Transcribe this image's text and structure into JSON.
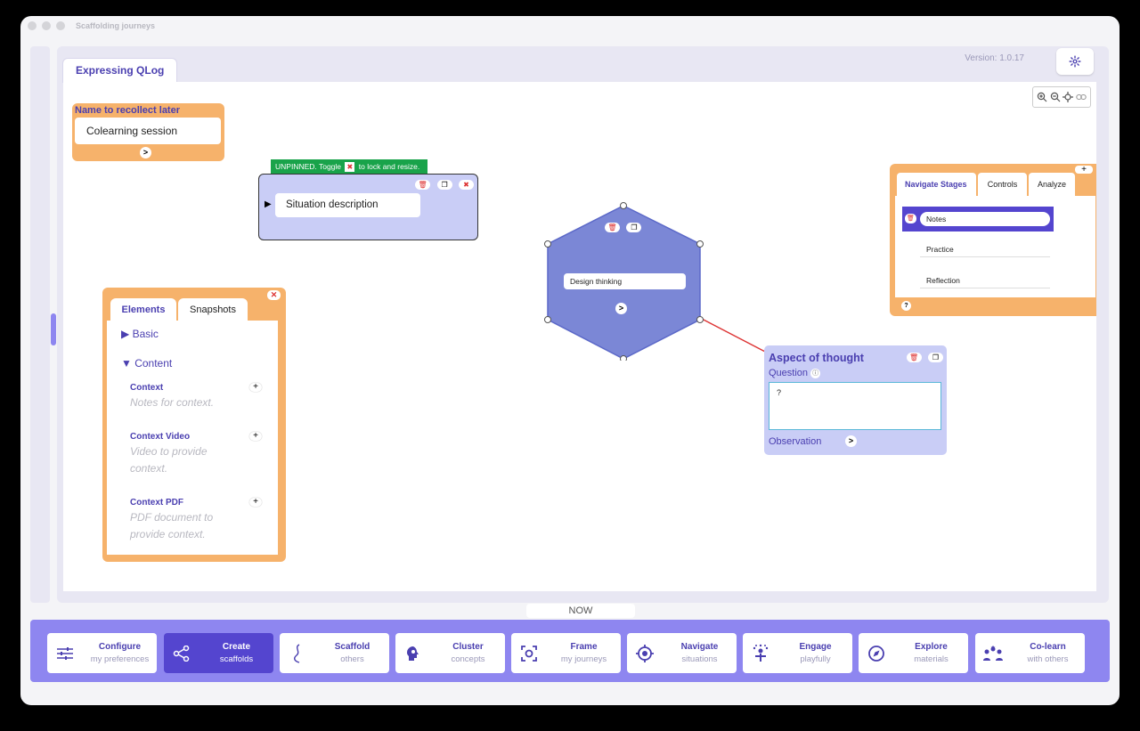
{
  "window": {
    "title": "Scaffolding journeys"
  },
  "header": {
    "tab": "Expressing QLog",
    "version": "Version: 1.0.17"
  },
  "name_card": {
    "label": "Name to recollect later",
    "value": "Colearning session",
    "next": ">"
  },
  "pin_banner": {
    "prefix": "UNPINNED. Toggle",
    "suffix": "to lock and resize."
  },
  "situation": {
    "arrow": "▶",
    "label": "Situation description"
  },
  "hexagon": {
    "label": "Design thinking",
    "next": ">"
  },
  "aspect": {
    "title": "Aspect of thought",
    "question_label": "Question",
    "question_value": "?",
    "observation_label": "Observation",
    "next": ">"
  },
  "elements_panel": {
    "tabs": [
      "Elements",
      "Snapshots"
    ],
    "groups": {
      "basic": "▶ Basic",
      "content": "▼ Content"
    },
    "items": [
      {
        "title": "Context",
        "desc": "Notes for context."
      },
      {
        "title": "Context Video",
        "desc": "Video to provide context."
      },
      {
        "title": "Context PDF",
        "desc": "PDF document to provide context."
      }
    ],
    "plus": "+"
  },
  "stages_panel": {
    "tabs": [
      "Navigate Stages",
      "Controls",
      "Analyze"
    ],
    "stages": [
      "Notes",
      "Practice",
      "Reflection"
    ],
    "help": "?",
    "plus": "+"
  },
  "now_label": "NOW",
  "nav": [
    {
      "title": "Configure",
      "sub": "my preferences",
      "icon": "sliders-icon"
    },
    {
      "title": "Create",
      "sub": "scaffolds",
      "icon": "nodes-icon"
    },
    {
      "title": "Scaffold",
      "sub": "others",
      "icon": "curve-icon"
    },
    {
      "title": "Cluster",
      "sub": "concepts",
      "icon": "brain-icon"
    },
    {
      "title": "Frame",
      "sub": "my journeys",
      "icon": "frame-icon"
    },
    {
      "title": "Navigate",
      "sub": "situations",
      "icon": "target-icon"
    },
    {
      "title": "Engage",
      "sub": "playfully",
      "icon": "engage-icon"
    },
    {
      "title": "Explore",
      "sub": "materials",
      "icon": "compass-icon"
    },
    {
      "title": "Co-learn",
      "sub": "with others",
      "icon": "people-icon"
    }
  ],
  "colors": {
    "accent": "#4a3fb0",
    "bar": "#8e86f0",
    "orange": "#f6b26b",
    "lavender": "#c9cdf6",
    "hex": "#7b87d6",
    "green": "#19a34a"
  }
}
